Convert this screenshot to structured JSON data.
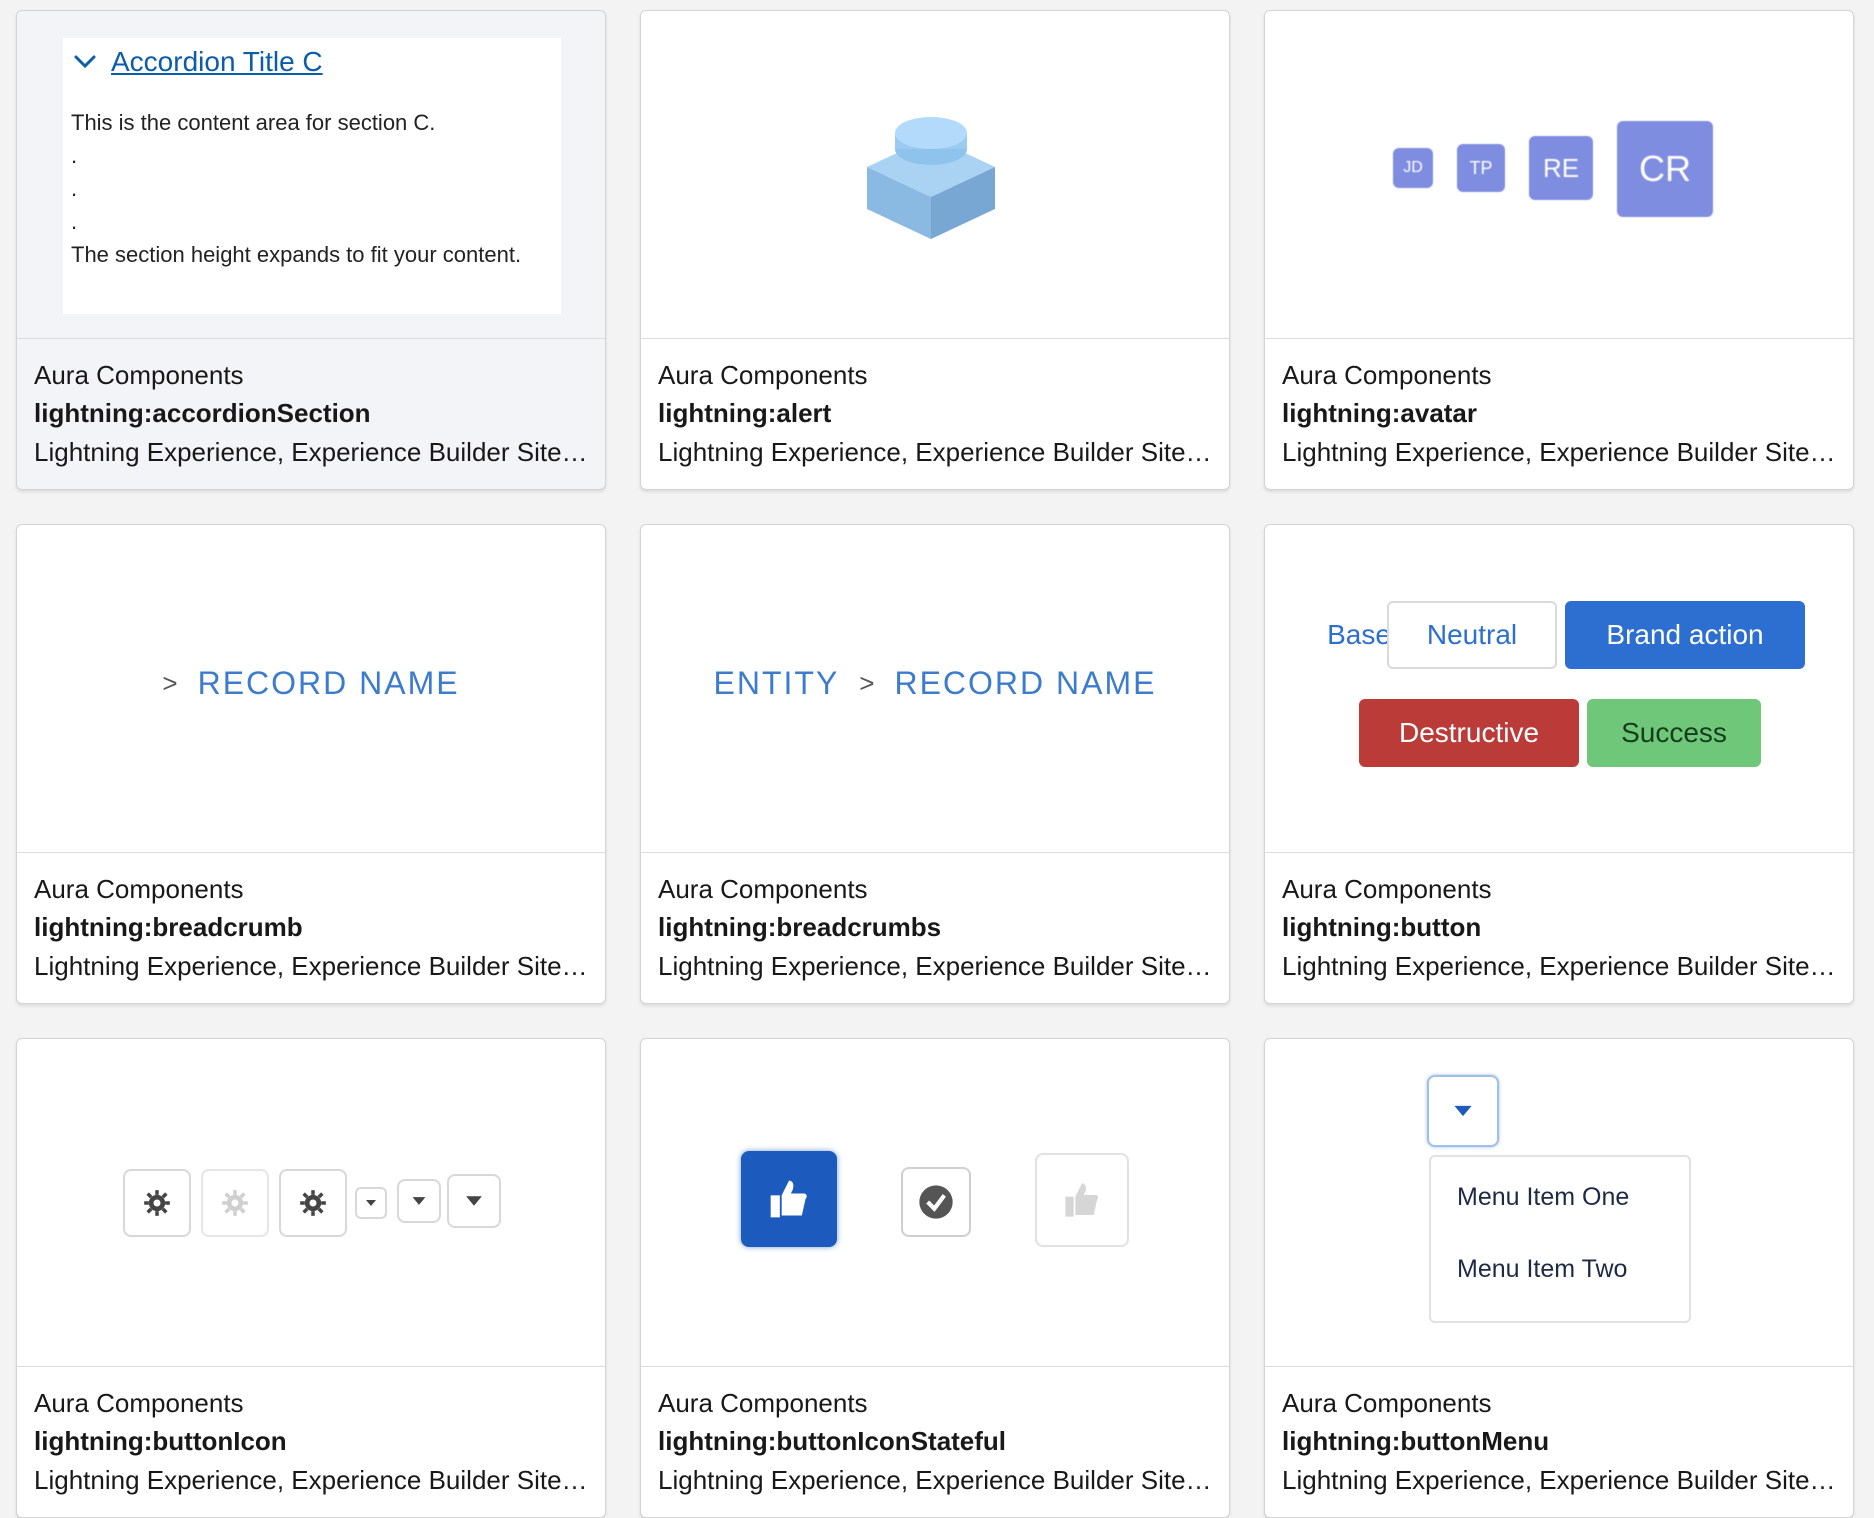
{
  "cards": [
    {
      "category": "Aura Components",
      "name": "lightning:accordionSection",
      "description": "Lightning Experience, Experience Builder Sites, Salesforce Mobile App, Standalone Lightning App, Mobile Offline",
      "preview": {
        "title": "Accordion Title C",
        "lines": [
          "This is the content area for section C.",
          ".",
          ".",
          ".",
          "The section height expands to fit your content."
        ]
      }
    },
    {
      "category": "Aura Components",
      "name": "lightning:alert",
      "description": "Lightning Experience, Experience Builder Sites, Salesforce Mobile App, Standalone Lightning App",
      "preview": {
        "icon": "lego-block-icon"
      }
    },
    {
      "category": "Aura Components",
      "name": "lightning:avatar",
      "description": "Lightning Experience, Experience Builder Sites, Salesforce Mobile App, Standalone Lightning App, Mobile Offline",
      "preview": {
        "avatars": [
          "JD",
          "TP",
          "RE",
          "CR"
        ]
      }
    },
    {
      "category": "Aura Components",
      "name": "lightning:breadcrumb",
      "description": "Lightning Experience, Experience Builder Sites, Salesforce Mobile App, Standalone Lightning App, Mobile Offline",
      "preview": {
        "separator": ">",
        "item": "RECORD NAME"
      }
    },
    {
      "category": "Aura Components",
      "name": "lightning:breadcrumbs",
      "description": "Lightning Experience, Experience Builder Sites, Salesforce Mobile App, Standalone Lightning App, Mobile Offline",
      "preview": {
        "item1": "ENTITY",
        "separator": ">",
        "item2": "RECORD NAME"
      }
    },
    {
      "category": "Aura Components",
      "name": "lightning:button",
      "description": "Lightning Experience, Experience Builder Sites, Salesforce Mobile App, Standalone Lightning App, Mobile Offline",
      "preview": {
        "base": "Base",
        "neutral": "Neutral",
        "brand": "Brand action",
        "destructive": "Destructive",
        "success": "Success"
      }
    },
    {
      "category": "Aura Components",
      "name": "lightning:buttonIcon",
      "description": "Lightning Experience, Experience Builder Sites, Salesforce Mobile App, Standalone Lightning App, Mobile Offline",
      "preview": {
        "icons": [
          "gear-icon",
          "gear-icon-disabled",
          "gear-icon",
          "down-icon",
          "down-icon",
          "down-icon"
        ]
      }
    },
    {
      "category": "Aura Components",
      "name": "lightning:buttonIconStateful",
      "description": "Lightning Experience, Experience Builder Sites, Salesforce Mobile App, Standalone Lightning App, Mobile Offline",
      "preview": {
        "icons": [
          "like-icon",
          "check-chat-icon",
          "like-icon-disabled"
        ]
      }
    },
    {
      "category": "Aura Components",
      "name": "lightning:buttonMenu",
      "description": "Lightning Experience, Experience Builder Sites, Salesforce Mobile App, Standalone Lightning App, Mobile Offline",
      "preview": {
        "items": [
          "Menu Item One",
          "Menu Item Two"
        ]
      }
    }
  ],
  "colors": {
    "accent": "#0b5cab",
    "brand": "#2c6fd1",
    "destructive": "#ba3b38",
    "success": "#6fc87a",
    "avatar": "#7f8de1",
    "crumb": "#3d7ccd"
  }
}
